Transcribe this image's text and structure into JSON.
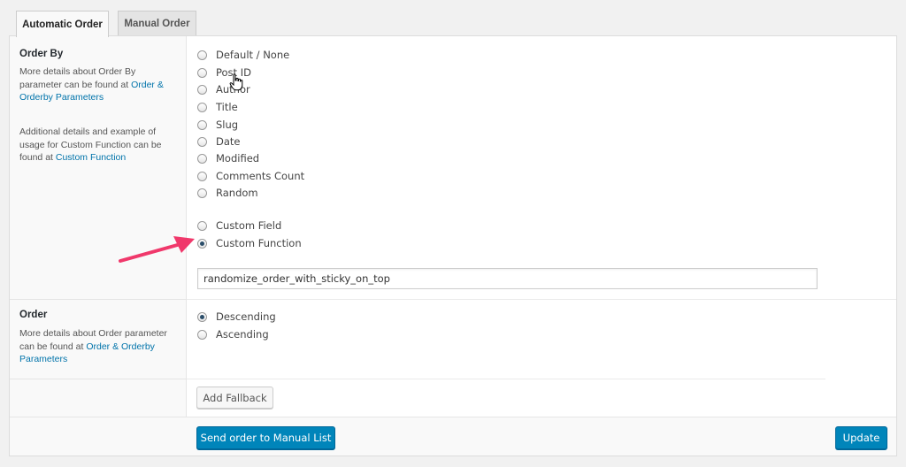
{
  "tabs": [
    {
      "label": "Automatic Order",
      "active": true
    },
    {
      "label": "Manual Order",
      "active": false
    }
  ],
  "order_by": {
    "title": "Order By",
    "help1_pre": "More details about Order By parameter can be found at ",
    "help1_link": "Order & Orderby Parameters",
    "help2_pre": "Additional details and example of usage for Custom Function can be found at ",
    "help2_link": "Custom Function",
    "options": [
      "Default / None",
      "Post ID",
      "Author",
      "Title",
      "Slug",
      "Date",
      "Modified",
      "Comments Count",
      "Random"
    ],
    "extra_options": [
      "Custom Field",
      "Custom Function"
    ],
    "selected": "Custom Function",
    "function_value": "randomize_order_with_sticky_on_top"
  },
  "order": {
    "title": "Order",
    "help_pre": "More details about Order parameter can be found at ",
    "help_link": "Order & Orderby Parameters",
    "options": [
      "Descending",
      "Ascending"
    ],
    "selected": "Descending"
  },
  "buttons": {
    "add_fallback": "Add Fallback",
    "send_manual": "Send order to Manual List",
    "update": "Update"
  },
  "colors": {
    "primary": "#0085ba",
    "link": "#0073aa",
    "arrow": "#f0386b"
  },
  "icons": {
    "arrow": "annotation-arrow-icon",
    "cursor": "hand-pointer-cursor-icon"
  }
}
